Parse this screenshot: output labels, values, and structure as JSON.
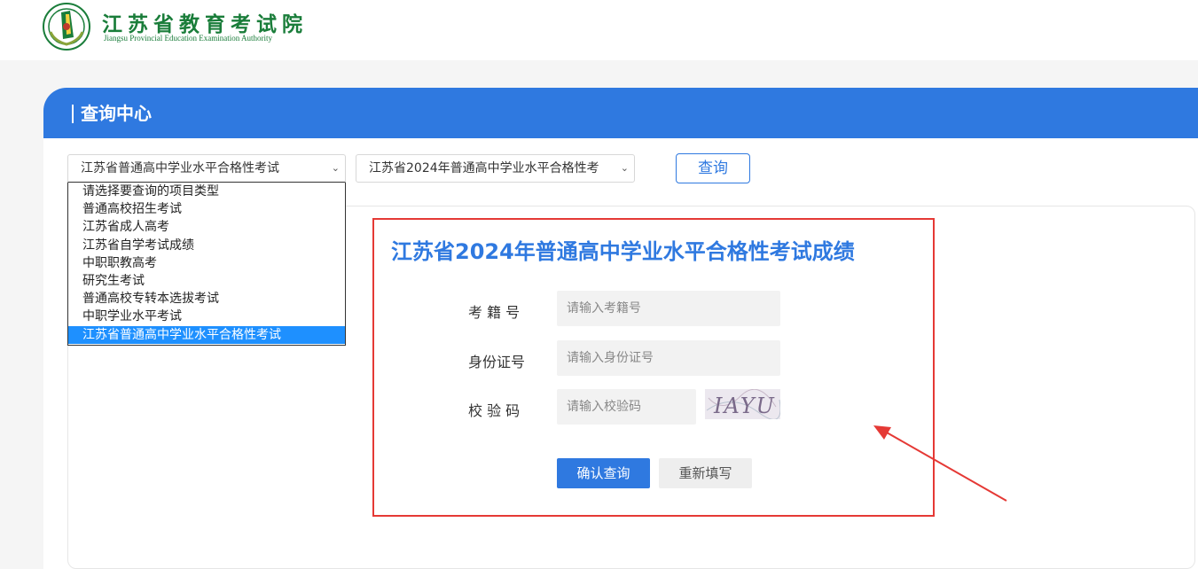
{
  "header": {
    "logo_cn": "江苏省教育考试院",
    "logo_en": "Jiangsu Provincial Education Examination Authority",
    "brand_color": "#1a7d3a"
  },
  "panel": {
    "title": "查询中心",
    "accent_color": "#2f79e0"
  },
  "selects": {
    "type_selected": "江苏省普通高中学业水平合格性考试",
    "exam_selected": "江苏省2024年普通高中学业水平合格性考",
    "search_label": "查询"
  },
  "dropdown": {
    "options": [
      "请选择要查询的项目类型",
      "普通高校招生考试",
      "江苏省成人高考",
      "江苏省自学考试成绩",
      "中职职教高考",
      "研究生考试",
      "普通高校专转本选拔考试",
      "中职学业水平考试",
      "江苏省普通高中学业水平合格性考试"
    ],
    "selected_index": 8
  },
  "form": {
    "title": "江苏省2024年普通高中学业水平合格性考试成绩",
    "fields": {
      "exam_no": {
        "label": "考 籍 号",
        "placeholder": "请输入考籍号",
        "value": ""
      },
      "id_no": {
        "label": "身份证号",
        "placeholder": "请输入身份证号",
        "value": ""
      },
      "captcha": {
        "label": "校 验 码",
        "placeholder": "请输入校验码",
        "value": ""
      }
    },
    "captcha_image_text": "IAYU",
    "confirm_label": "确认查询",
    "reset_label": "重新填写"
  },
  "annotation": {
    "highlight_color": "#e53935"
  }
}
